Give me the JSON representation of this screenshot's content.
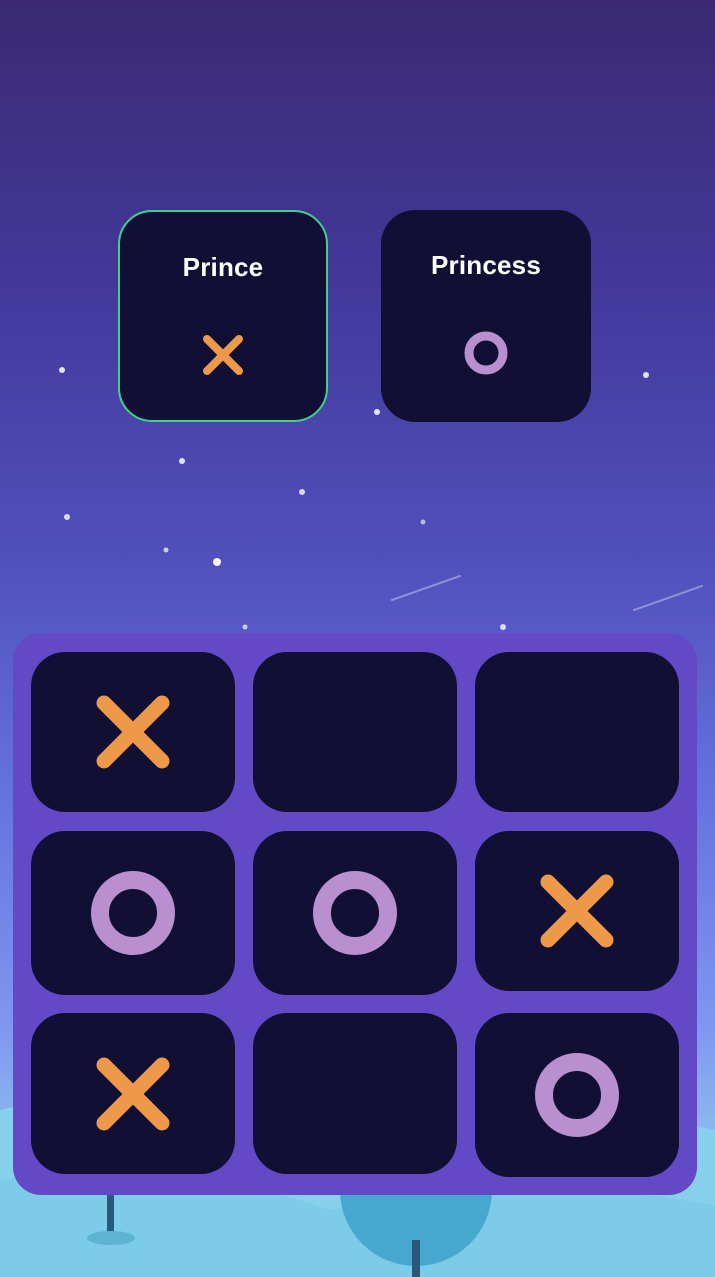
{
  "colors": {
    "x_mark": "#ee994a",
    "o_mark": "#b98fcf",
    "cell_bg": "#110f33",
    "board_bg": "#6349c6",
    "active_border": "#3fd08c"
  },
  "players": [
    {
      "name": "Prince",
      "mark": "X",
      "active": true
    },
    {
      "name": "Princess",
      "mark": "O",
      "active": false
    }
  ],
  "board": {
    "cells": [
      "X",
      "",
      "",
      "O",
      "O",
      "X",
      "X",
      "",
      "O"
    ]
  }
}
